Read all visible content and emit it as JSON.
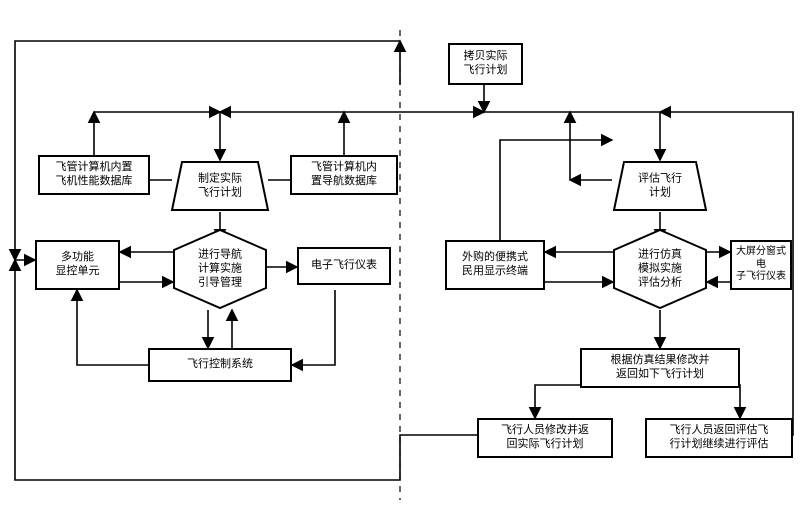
{
  "nodes": {
    "copyPlan": "拷贝实际\n飞行计划",
    "perfDb": "飞管计算机内置\n飞机性能数据库",
    "navDb": "飞管计算机内\n置导航数据库",
    "makePlan": "制定实际\n飞行计划",
    "evalPlan": "评估飞行\n计划",
    "mfd": "多功能\n显控单元",
    "navMgmt": "进行导航\n计算实施\n引导管理",
    "efi": "电子飞行仪表",
    "portable": "外购的便携式\n民用显示终端",
    "simAnalyze": "进行仿真\n模拟实施\n评估分析",
    "splitEfi": "大屏分窗式电\n子飞行仪表",
    "fcs": "飞行控制系统",
    "simModify": "根据仿真结果修改并\n返回如下飞行计划",
    "crewModify": "飞行人员修改并返\n回实际飞行计划",
    "crewReturn": "飞行人员返回评估飞\n行计划继续进行评估"
  }
}
